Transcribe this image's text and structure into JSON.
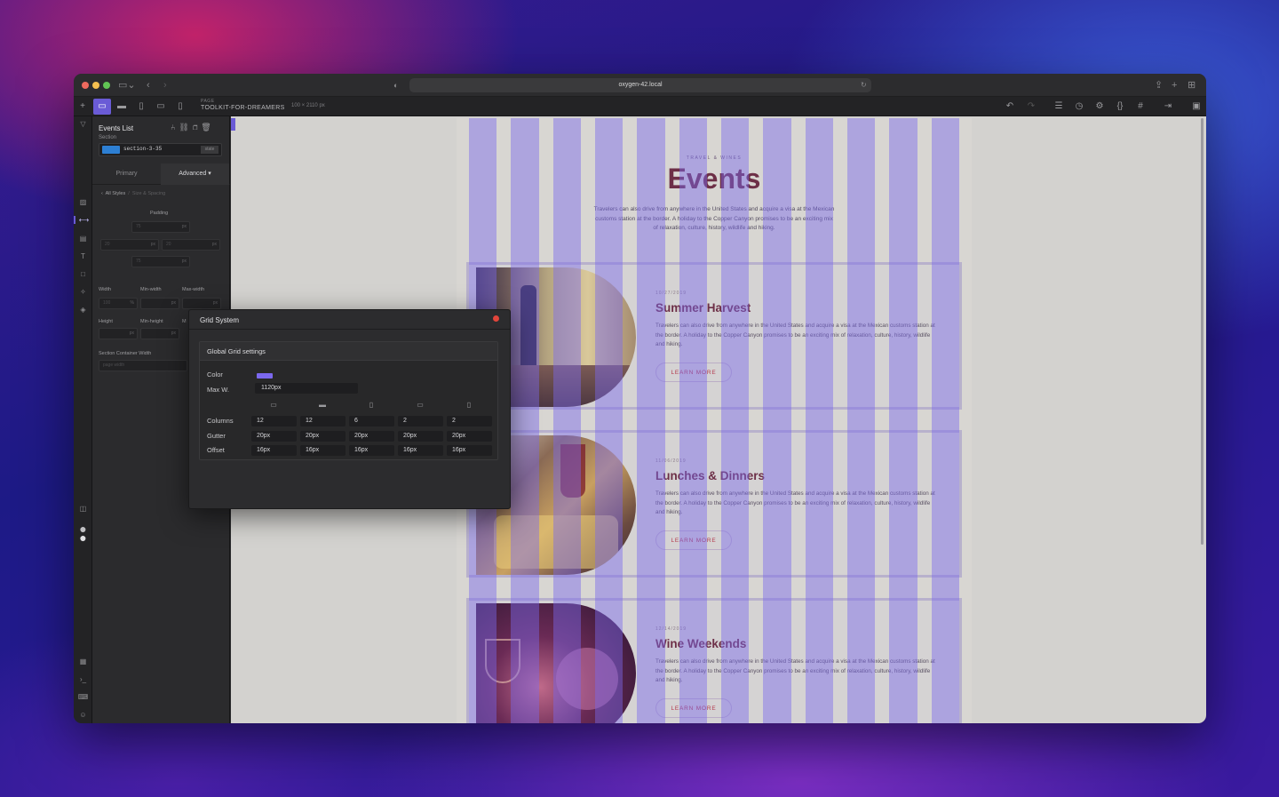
{
  "browser": {
    "url": "oxygen-42.local"
  },
  "toolbar": {
    "page_label": "PAGE",
    "page_name": "TOOLKIT-FOR-DREAMERS",
    "width_value": "100",
    "height_value": "2110",
    "dims_unit": "px"
  },
  "panel": {
    "title": "Events List",
    "subtitle": "Section",
    "selector_id": "section-3-35",
    "selector_state": "state",
    "tabs": {
      "primary": "Primary",
      "advanced": "Advanced"
    },
    "breadcrumb": {
      "root": "All Styles",
      "current": "Size & Spacing"
    },
    "padding_label": "Padding",
    "padding_top": "75",
    "padding_left": "20",
    "padding_right": "20",
    "padding_bottom": "75",
    "unit_px": "px",
    "unit_pct": "%",
    "width_label": "Width",
    "min_width_label": "Min-width",
    "max_width_label": "Max-width",
    "width_value": "100",
    "height_label": "Height",
    "min_height_label": "Min-height",
    "max_height_label": "M",
    "section_container_width_label": "Section Container Width",
    "section_container_width_placeholder": "page width"
  },
  "grid_modal": {
    "title": "Grid System",
    "section_title": "Global Grid settings",
    "color_label": "Color",
    "color_value": "#7b68ee",
    "maxw_label": "Max W.",
    "maxw_value": "1120px",
    "devices": [
      "desktop-icon",
      "laptop-icon",
      "tablet-icon",
      "tablet-landscape-icon",
      "phone-icon"
    ],
    "rows": [
      {
        "label": "Columns",
        "values": [
          "12",
          "12",
          "6",
          "2",
          "2"
        ]
      },
      {
        "label": "Gutter",
        "values": [
          "20px",
          "20px",
          "20px",
          "20px",
          "20px"
        ]
      },
      {
        "label": "Offset",
        "values": [
          "16px",
          "16px",
          "16px",
          "16px",
          "16px"
        ]
      }
    ]
  },
  "canvas": {
    "kicker": "TRAVEL & WINES",
    "heading": "Events",
    "lead": "Travelers can also drive from anywhere in the United States and acquire a visa at the Mexican customs station at the border. A holiday to the Copper Canyon promises to be an exciting mix of relaxation, culture, history, wildlife and hiking.",
    "cards": [
      {
        "date": "10/27/2019",
        "title": "Summer Harvest",
        "text": "Travelers can also drive from anywhere in the United States and acquire a visa at the Mexican customs station at the border. A holiday to the Copper Canyon promises to be an exciting mix of relaxation, culture, history, wildlife and hiking.",
        "button": "LEARN MORE"
      },
      {
        "date": "11/06/2019",
        "title": "Lunches & Dinners",
        "text": "Travelers can also drive from anywhere in the United States and acquire a visa at the Mexican customs station at the border. A holiday to the Copper Canyon promises to be an exciting mix of relaxation, culture, history, wildlife and hiking.",
        "button": "LEARN MORE"
      },
      {
        "date": "12/14/2019",
        "title": "Wine Weekends",
        "text": "Travelers can also drive from anywhere in the United States and acquire a visa at the Mexican customs station at the border. A holiday to the Copper Canyon promises to be an exciting mix of relaxation, culture, history, wildlife and hiking.",
        "button": "LEARN MORE"
      }
    ]
  },
  "colors": {
    "accent": "#6a5bd6",
    "grid_overlay": "#7b68ee",
    "heading": "#6d2f47",
    "button_text": "#b3394d"
  }
}
